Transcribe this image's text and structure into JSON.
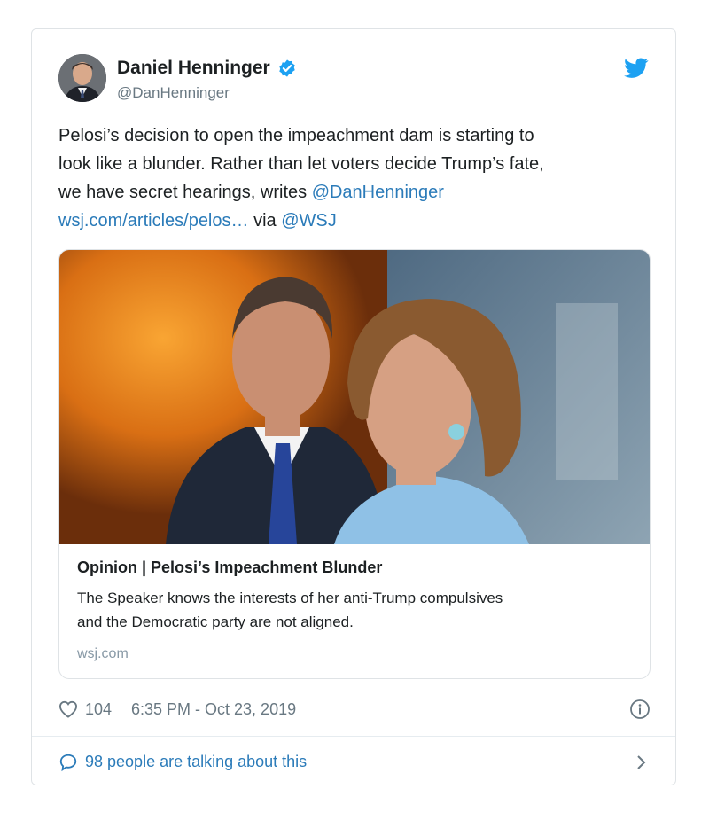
{
  "author": {
    "name": "Daniel Henninger",
    "handle": "@DanHenninger",
    "avatar_icon": "portrait-photo",
    "verified_icon": "verified-badge-icon"
  },
  "brand": {
    "icon": "twitter-bird-icon",
    "color": "#1da1f2"
  },
  "tweet": {
    "line1": "Pelosi’s decision to open the impeachment dam is starting to",
    "line2": "look like a blunder. Rather than let voters decide Trump’s fate,",
    "line3_text": "we have secret hearings, writes ",
    "line3_mention": "@DanHenninger",
    "link_url": "wsj.com/articles/pelos…",
    "via_text": " via ",
    "via_mention": "@WSJ"
  },
  "card": {
    "image": "photo of two politicians at a press conference",
    "title": "Opinion | Pelosi’s Impeachment Blunder",
    "description_line1": "The Speaker knows the interests of her anti-Trump compulsives",
    "description_line2": "and the Democratic party are not aligned.",
    "domain": "wsj.com"
  },
  "meta": {
    "likes": "104",
    "timestamp": "6:35 PM - Oct 23, 2019"
  },
  "footer": {
    "talking": "98 people are talking about this"
  },
  "colors": {
    "link": "#2b7bb9",
    "text": "#1c2022",
    "muted": "#697882",
    "border": "#dfe3e6"
  }
}
